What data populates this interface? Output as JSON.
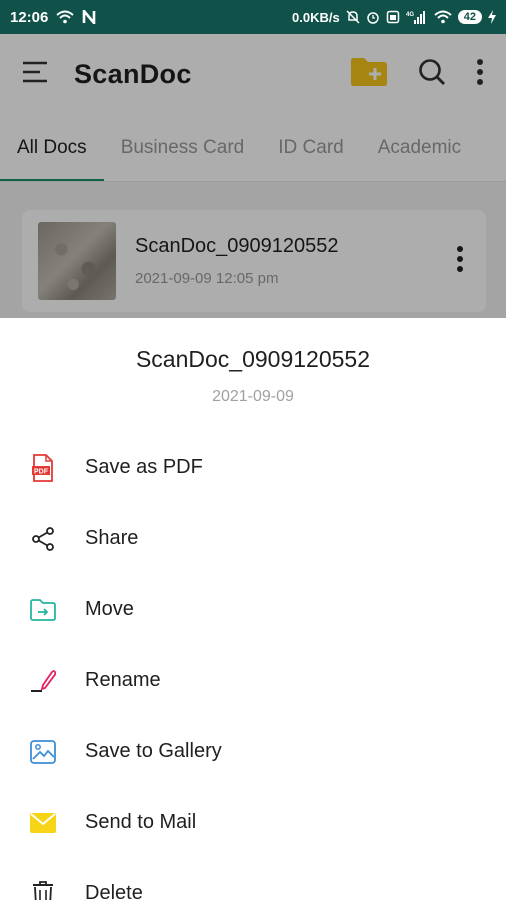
{
  "status_bar": {
    "time": "12:06",
    "network_speed": "0.0KB/s",
    "signal_type": "4G",
    "battery": "42"
  },
  "app_bar": {
    "title": "ScanDoc"
  },
  "tabs": [
    {
      "label": "All Docs",
      "active": true
    },
    {
      "label": "Business Card",
      "active": false
    },
    {
      "label": "ID Card",
      "active": false
    },
    {
      "label": "Academic",
      "active": false
    }
  ],
  "document": {
    "name": "ScanDoc_0909120552",
    "date": "2021-09-09  12:05 pm"
  },
  "sheet": {
    "title": "ScanDoc_0909120552",
    "date": "2021-09-09",
    "items": [
      {
        "label": "Save as PDF",
        "icon": "pdf-icon"
      },
      {
        "label": "Share",
        "icon": "share-icon"
      },
      {
        "label": "Move",
        "icon": "move-folder-icon"
      },
      {
        "label": "Rename",
        "icon": "pencil-icon"
      },
      {
        "label": "Save to Gallery",
        "icon": "gallery-icon"
      },
      {
        "label": "Send to Mail",
        "icon": "mail-icon"
      },
      {
        "label": "Delete",
        "icon": "trash-icon"
      }
    ]
  },
  "colors": {
    "status_bar": "#10524a",
    "accent": "#1a8f6e",
    "folder": "#f5c518",
    "pdf": "#e53935",
    "mail": "#f7d417"
  }
}
